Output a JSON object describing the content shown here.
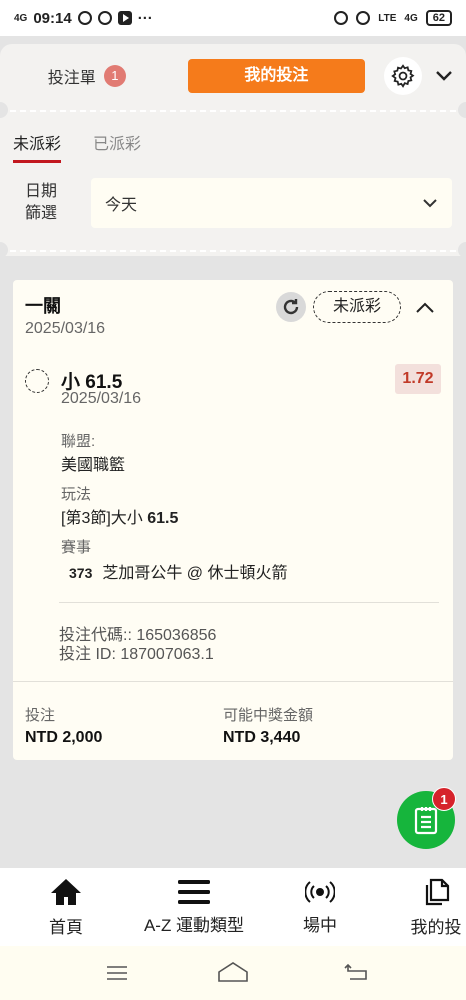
{
  "status_bar": {
    "signal": "4G",
    "time": "09:14",
    "more": "···",
    "lte_label": "LTE",
    "net_label": "4G",
    "battery": "62"
  },
  "top_tabs": {
    "betslip_label": "投注單",
    "betslip_count": "1",
    "my_bets_label": "我的投注"
  },
  "sub_tabs": {
    "unsettled": "未派彩",
    "settled": "已派彩"
  },
  "date_filter": {
    "label": "日期\n篩選",
    "value": "今天"
  },
  "bet": {
    "type": "一關",
    "date": "2025/03/16",
    "status": "未派彩",
    "selection": "小 61.5",
    "selection_date": "2025/03/16",
    "odds": "1.72",
    "league_label": "聯盟:",
    "league": "美國職籃",
    "market_label": "玩法",
    "market_prefix": "[第3節]大小 ",
    "market_line": "61.5",
    "event_label": "賽事",
    "event_number": "373",
    "event_name": "芝加哥公牛 @ 休士頓火箭",
    "bet_code": "投注代碼:: 165036856",
    "bet_id": "投注 ID: 187007063.1",
    "stake_label": "投注",
    "stake": "NTD 2,000",
    "payout_label": "可能中獎金額",
    "payout": "NTD 3,440"
  },
  "fab": {
    "badge": "1"
  },
  "bottom_nav": [
    {
      "label": "首頁",
      "icon": "home-icon"
    },
    {
      "label": "A-Z 運動類型",
      "icon": "menu-icon"
    },
    {
      "label": "場中",
      "icon": "live-icon"
    },
    {
      "label": "我的投",
      "icon": "copy-icon"
    }
  ],
  "colors": {
    "accent": "#f57b1b",
    "active_tab": "#c2181f",
    "fab": "#16b53c",
    "odds": "#c13a28"
  }
}
